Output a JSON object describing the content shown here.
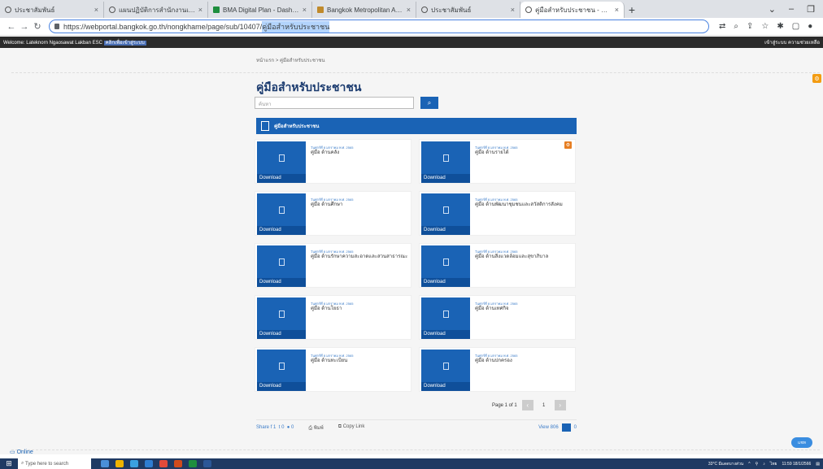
{
  "browser": {
    "tabs": [
      {
        "title": "ประชาสัมพันธ์",
        "icon": "info-icon"
      },
      {
        "title": "แผนปฏิบัติการสำนักงานเขต",
        "icon": "info-icon"
      },
      {
        "title": "BMA Digital Plan - Dashboard",
        "icon": "sheet-icon"
      },
      {
        "title": "Bangkok Metropolitan Administr",
        "icon": "gov-icon"
      },
      {
        "title": "ประชาสัมพันธ์",
        "icon": "info-icon"
      },
      {
        "title": "คู่มือสำหรับประชาชน - สำนักงานเขต",
        "icon": "info-icon",
        "active": true
      }
    ],
    "url_prefix": "https://webportal.bangkok.go.th/nongkhame/page/sub/10407/",
    "url_selected": "คู่มือสำหรับประชาชน",
    "biz_left": "Welcome: Lateknorn Ngaosawat   Lakban ESC",
    "biz_link": "คลิกเพื่อเข้าสู่ระบบ",
    "biz_right": "เข้าสู่ระบบ  ความช่วยเหลือ"
  },
  "page": {
    "breadcrumb": "หน้าแรก > คู่มือสำหรับประชาชน",
    "heading": "คู่มือสำหรับประชาชน",
    "search_placeholder": "ค้นหา",
    "search_icon": "search-icon",
    "section_title": "คู่มือสำหรับประชาชน",
    "download_label": "Download",
    "cards": [
      {
        "date": "วันศุกร์ที่ 8 มกราคม พ.ศ. 2565",
        "title": "คู่มือ ด้านคลัง"
      },
      {
        "date": "วันศุกร์ที่ 8 มกราคม พ.ศ. 2565",
        "title": "คู่มือ ด้านรายได้"
      },
      {
        "date": "วันศุกร์ที่ 8 มกราคม พ.ศ. 2565",
        "title": "คู่มือ ด้านศึกษา"
      },
      {
        "date": "วันศุกร์ที่ 8 มกราคม พ.ศ. 2565",
        "title": "คู่มือ ด้านพัฒนาชุมชนและสวัสดิการสังคม"
      },
      {
        "date": "วันศุกร์ที่ 8 มกราคม พ.ศ. 2565",
        "title": "คู่มือ ด้านรักษาความสะอาดและสวนสาธารณะ"
      },
      {
        "date": "วันศุกร์ที่ 8 มกราคม พ.ศ. 2565",
        "title": "คู่มือ ด้านสิ่งแวดล้อมและสุขาภิบาล"
      },
      {
        "date": "วันศุกร์ที่ 8 มกราคม พ.ศ. 2565",
        "title": "คู่มือ ด้านโยธา"
      },
      {
        "date": "วันศุกร์ที่ 8 มกราคม พ.ศ. 2565",
        "title": "คู่มือ ด้านเทศกิจ"
      },
      {
        "date": "วันศุกร์ที่ 8 มกราคม พ.ศ. 2565",
        "title": "คู่มือ ด้านทะเบียน"
      },
      {
        "date": "วันศุกร์ที่ 8 มกราคม พ.ศ. 2565",
        "title": "คู่มือ ด้านปกครอง"
      }
    ],
    "pager": {
      "label": "Page 1 of 1",
      "current": "1"
    },
    "share": {
      "label": "Share",
      "fb": "1",
      "tw": "0",
      "line": "0",
      "print": "พิมพ์",
      "copy": "Copy Link",
      "view": "View 806",
      "likes": "0"
    },
    "online": "Online",
    "chat": "แชท"
  },
  "taskbar": {
    "search_placeholder": "Type here to search",
    "weather": "33°C มีแดดบางส่วน",
    "lang": "ไทย",
    "time": "11:59",
    "date": "18/1/2566"
  }
}
